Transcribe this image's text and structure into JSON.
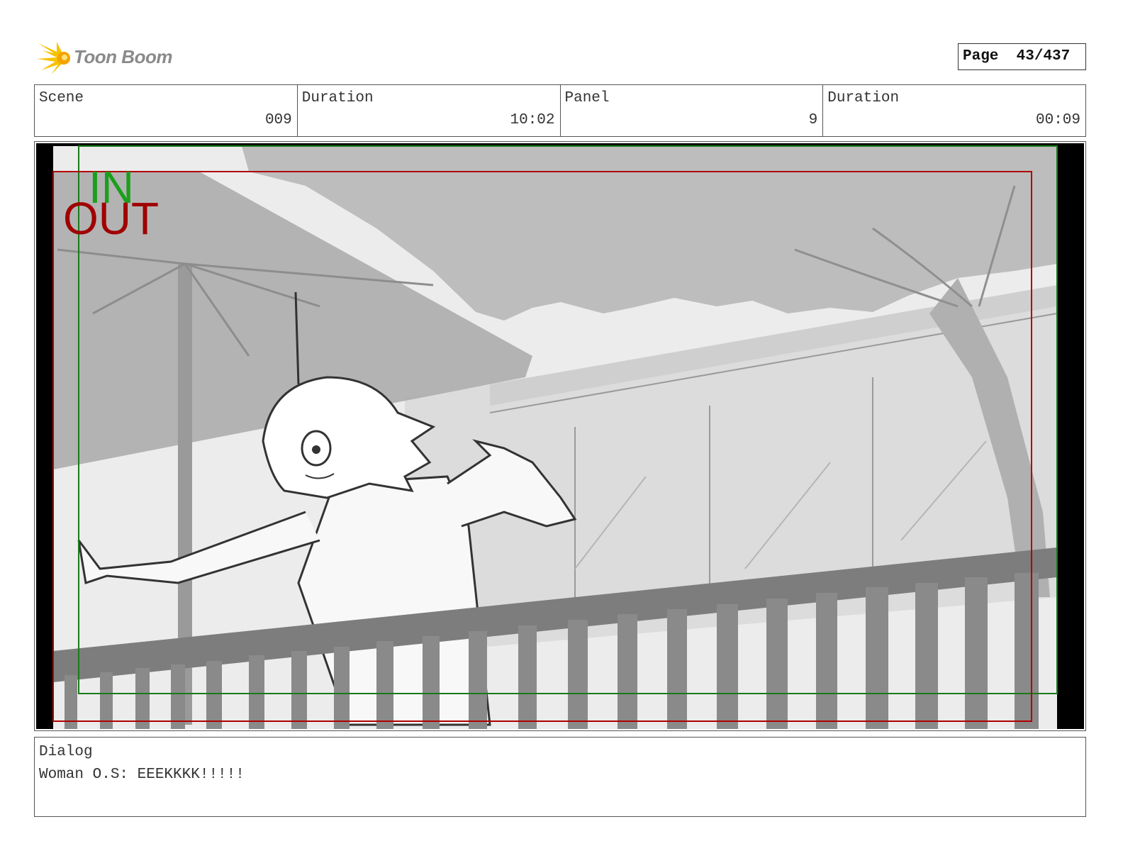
{
  "brand": {
    "name": "Toon Boom"
  },
  "page": {
    "label": "Page",
    "value": "43/437"
  },
  "info": {
    "scene_label": "Scene",
    "scene_value": "009",
    "scene_duration_label": "Duration",
    "scene_duration_value": "10:02",
    "panel_label": "Panel",
    "panel_value": "9",
    "panel_duration_label": "Duration",
    "panel_duration_value": "00:09"
  },
  "panel": {
    "in_marker": "IN",
    "out_marker": "OUT",
    "in_color": "#1aa01a",
    "out_color": "#a00000"
  },
  "dialog": {
    "label": "Dialog",
    "text": "Woman O.S: EEEKKKK!!!!!"
  },
  "icons": {
    "logo": "starburst-logo-icon"
  }
}
